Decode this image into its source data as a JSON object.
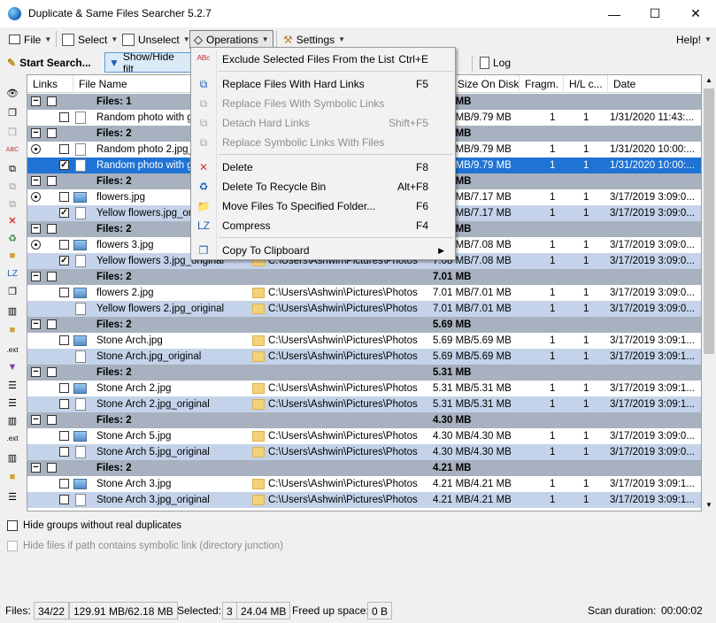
{
  "window": {
    "title": "Duplicate & Same Files Searcher 5.2.7",
    "minimize": "—",
    "maximize": "☐",
    "close": "✕"
  },
  "menubar": {
    "file": "File",
    "select": "Select",
    "unselect": "Unselect",
    "operations": "Operations",
    "settings": "Settings",
    "help": "Help!"
  },
  "toolbar": {
    "start_search": "Start Search...",
    "show_hide": "Show/Hide filt",
    "log": "Log"
  },
  "columns": {
    "links": "Links",
    "file_name": "File Name",
    "size_on_disk": "Size On Disk",
    "fragm": "Fragm.",
    "hl": "H/L c...",
    "date": "Date"
  },
  "rows": [
    {
      "type": "group",
      "label": "Files: 1",
      "size": "9.79 MB"
    },
    {
      "type": "file",
      "radio": false,
      "checked": false,
      "icon": "file",
      "name": "Random photo with gps.jpg",
      "path": "",
      "size": "9.79 MB/9.79 MB",
      "fragm": "1",
      "hl": "1",
      "date": "1/31/2020 11:43:...",
      "style": "odd"
    },
    {
      "type": "group",
      "label": "Files: 2",
      "size": "9.79 MB"
    },
    {
      "type": "file",
      "radio": true,
      "checked": false,
      "icon": "file",
      "name": "Random photo 2.jpg_original",
      "path": "",
      "size": "9.79 MB/9.79 MB",
      "fragm": "1",
      "hl": "1",
      "date": "1/31/2020 10:00:...",
      "style": "odd"
    },
    {
      "type": "file",
      "radio": false,
      "checked": true,
      "icon": "file",
      "name": "Random photo with gps.jpg",
      "path": "",
      "size": "9.79 MB/9.79 MB",
      "fragm": "1",
      "hl": "1",
      "date": "1/31/2020 10:00:...",
      "style": "sel"
    },
    {
      "type": "group",
      "label": "Files: 2",
      "size": "7.17 MB"
    },
    {
      "type": "file",
      "radio": true,
      "checked": false,
      "icon": "img",
      "name": "flowers.jpg",
      "path": "",
      "size": "7.17 MB/7.17 MB",
      "fragm": "1",
      "hl": "1",
      "date": "3/17/2019 3:09:0...",
      "style": "odd"
    },
    {
      "type": "file",
      "radio": false,
      "checked": true,
      "icon": "file",
      "name": "Yellow flowers.jpg_original",
      "path": "",
      "size": "7.17 MB/7.17 MB",
      "fragm": "1",
      "hl": "1",
      "date": "3/17/2019 3:09:0...",
      "style": "even"
    },
    {
      "type": "group",
      "label": "Files: 2",
      "size": "7.08 MB"
    },
    {
      "type": "file",
      "radio": true,
      "checked": false,
      "icon": "img",
      "name": "flowers 3.jpg",
      "path": "",
      "size": "7.08 MB/7.08 MB",
      "fragm": "1",
      "hl": "1",
      "date": "3/17/2019 3:09:0...",
      "style": "odd"
    },
    {
      "type": "file",
      "radio": false,
      "checked": true,
      "icon": "file",
      "name": "Yellow flowers 3.jpg_original",
      "path": "C:\\Users\\Ashwin\\Pictures\\Photos",
      "size": "7.08 MB/7.08 MB",
      "fragm": "1",
      "hl": "1",
      "date": "3/17/2019 3:09:0...",
      "style": "even"
    },
    {
      "type": "group",
      "label": "Files: 2",
      "size": "7.01 MB"
    },
    {
      "type": "file",
      "radio": false,
      "checked": false,
      "icon": "img",
      "name": "flowers 2.jpg",
      "path": "C:\\Users\\Ashwin\\Pictures\\Photos",
      "size": "7.01 MB/7.01 MB",
      "fragm": "1",
      "hl": "1",
      "date": "3/17/2019 3:09:0...",
      "style": "odd"
    },
    {
      "type": "file",
      "radio": false,
      "checked": null,
      "icon": "file",
      "name": "Yellow flowers 2.jpg_original",
      "path": "C:\\Users\\Ashwin\\Pictures\\Photos",
      "size": "7.01 MB/7.01 MB",
      "fragm": "1",
      "hl": "1",
      "date": "3/17/2019 3:09:0...",
      "style": "even"
    },
    {
      "type": "group",
      "label": "Files: 2",
      "size": "5.69 MB"
    },
    {
      "type": "file",
      "radio": false,
      "checked": false,
      "icon": "img",
      "name": "Stone Arch.jpg",
      "path": "C:\\Users\\Ashwin\\Pictures\\Photos",
      "size": "5.69 MB/5.69 MB",
      "fragm": "1",
      "hl": "1",
      "date": "3/17/2019 3:09:1...",
      "style": "odd"
    },
    {
      "type": "file",
      "radio": false,
      "checked": null,
      "icon": "file",
      "name": "Stone Arch.jpg_original",
      "path": "C:\\Users\\Ashwin\\Pictures\\Photos",
      "size": "5.69 MB/5.69 MB",
      "fragm": "1",
      "hl": "1",
      "date": "3/17/2019 3:09:1...",
      "style": "even"
    },
    {
      "type": "group",
      "label": "Files: 2",
      "size": "5.31 MB"
    },
    {
      "type": "file",
      "radio": false,
      "checked": false,
      "icon": "img",
      "name": "Stone Arch 2.jpg",
      "path": "C:\\Users\\Ashwin\\Pictures\\Photos",
      "size": "5.31 MB/5.31 MB",
      "fragm": "1",
      "hl": "1",
      "date": "3/17/2019 3:09:1...",
      "style": "odd"
    },
    {
      "type": "file",
      "radio": false,
      "checked": false,
      "icon": "file",
      "name": "Stone Arch 2.jpg_original",
      "path": "C:\\Users\\Ashwin\\Pictures\\Photos",
      "size": "5.31 MB/5.31 MB",
      "fragm": "1",
      "hl": "1",
      "date": "3/17/2019 3:09:1...",
      "style": "even"
    },
    {
      "type": "group",
      "label": "Files: 2",
      "size": "4.30 MB"
    },
    {
      "type": "file",
      "radio": false,
      "checked": false,
      "icon": "img",
      "name": "Stone Arch 5.jpg",
      "path": "C:\\Users\\Ashwin\\Pictures\\Photos",
      "size": "4.30 MB/4.30 MB",
      "fragm": "1",
      "hl": "1",
      "date": "3/17/2019 3:09:0...",
      "style": "odd"
    },
    {
      "type": "file",
      "radio": false,
      "checked": false,
      "icon": "file",
      "name": "Stone Arch 5.jpg_original",
      "path": "C:\\Users\\Ashwin\\Pictures\\Photos",
      "size": "4.30 MB/4.30 MB",
      "fragm": "1",
      "hl": "1",
      "date": "3/17/2019 3:09:0...",
      "style": "even"
    },
    {
      "type": "group",
      "label": "Files: 2",
      "size": "4.21 MB"
    },
    {
      "type": "file",
      "radio": false,
      "checked": false,
      "icon": "img",
      "name": "Stone Arch 3.jpg",
      "path": "C:\\Users\\Ashwin\\Pictures\\Photos",
      "size": "4.21 MB/4.21 MB",
      "fragm": "1",
      "hl": "1",
      "date": "3/17/2019 3:09:1...",
      "style": "odd"
    },
    {
      "type": "file",
      "radio": false,
      "checked": false,
      "icon": "file",
      "name": "Stone Arch 3.jpg_original",
      "path": "C:\\Users\\Ashwin\\Pictures\\Photos",
      "size": "4.21 MB/4.21 MB",
      "fragm": "1",
      "hl": "1",
      "date": "3/17/2019 3:09:1...",
      "style": "even"
    }
  ],
  "operations_menu": [
    {
      "label": "Exclude Selected Files From the List",
      "shortcut": "Ctrl+E",
      "enabled": true,
      "icon": "exclude-icon",
      "glyph": "ᴬᴮᶜ"
    },
    {
      "sep": true
    },
    {
      "label": "Replace Files With Hard Links",
      "shortcut": "F5",
      "enabled": true,
      "icon": "hard-link-icon",
      "glyph": "⧉"
    },
    {
      "label": "Replace Files With Symbolic Links",
      "shortcut": "",
      "enabled": false,
      "icon": "symbolic-link-icon",
      "glyph": "⧉"
    },
    {
      "label": "Detach Hard Links",
      "shortcut": "Shift+F5",
      "enabled": false,
      "icon": "detach-icon",
      "glyph": "⧉"
    },
    {
      "label": "Replace Symbolic Links With Files",
      "shortcut": "",
      "enabled": false,
      "icon": "replace-symlink-icon",
      "glyph": "⧉"
    },
    {
      "sep": true
    },
    {
      "label": "Delete",
      "shortcut": "F8",
      "enabled": true,
      "icon": "delete-icon",
      "glyph": "✕"
    },
    {
      "label": "Delete To Recycle Bin",
      "shortcut": "Alt+F8",
      "enabled": true,
      "icon": "recycle-bin-icon",
      "glyph": "♻"
    },
    {
      "label": "Move Files To Specified Folder...",
      "shortcut": "F6",
      "enabled": true,
      "icon": "move-folder-icon",
      "glyph": "📁"
    },
    {
      "label": "Compress",
      "shortcut": "F4",
      "enabled": true,
      "icon": "compress-icon",
      "glyph": "LZ"
    },
    {
      "sep": true
    },
    {
      "label": "Copy To Clipboard",
      "shortcut": "",
      "enabled": true,
      "submenu": true,
      "icon": "clipboard-icon",
      "glyph": "❐"
    }
  ],
  "options": {
    "hide_groups": "Hide groups without real duplicates",
    "hide_symlink": "Hide files if path contains symbolic link (directory junction)"
  },
  "status": {
    "files_label": "Files:",
    "files_count": "34/22",
    "files_size": "129.91 MB/62.18 MB",
    "selected_label": "Selected:",
    "selected_count": "3",
    "selected_size": "24.04 MB",
    "freed_label": "Freed up space:",
    "freed_value": "0 B",
    "duration_label": "Scan duration:",
    "duration_value": "00:00:02"
  },
  "colors": {
    "group_row": "#a7b1bf",
    "alt_row": "#c4d3ea",
    "selected_row": "#1e73d4"
  }
}
